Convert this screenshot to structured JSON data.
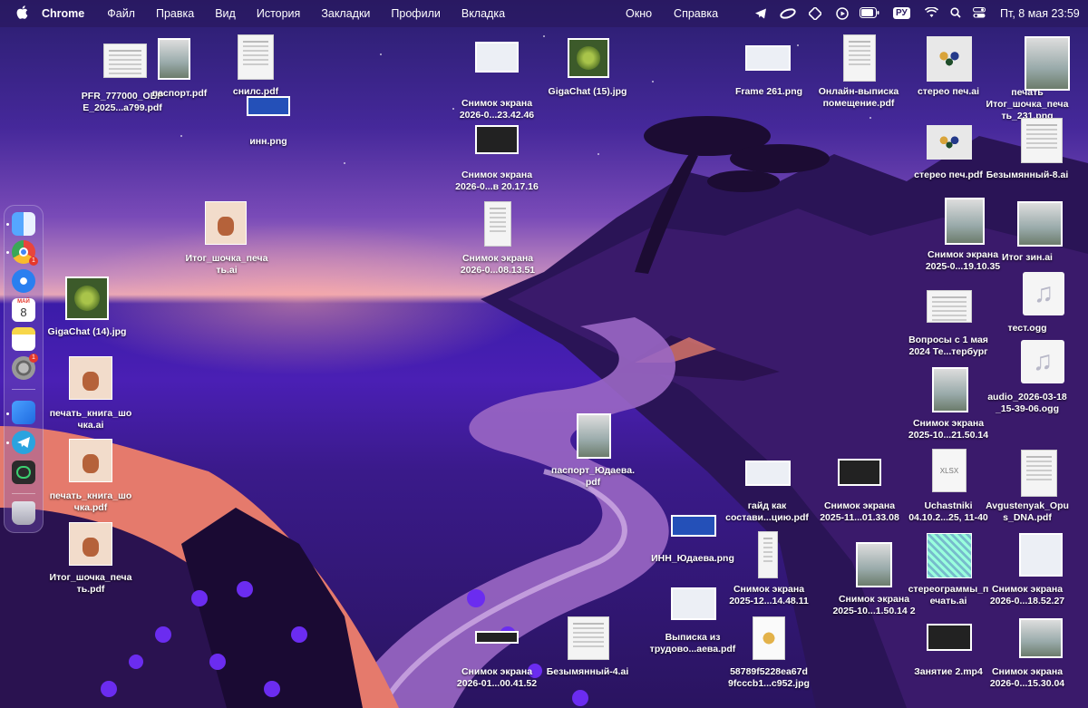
{
  "menubar": {
    "app_name": "Chrome",
    "menus": [
      "Файл",
      "Правка",
      "Вид",
      "История",
      "Закладки",
      "Профили",
      "Вкладка"
    ],
    "right_menus": [
      "Окно",
      "Справка"
    ],
    "input_source": "РУ",
    "clock": "Пт, 8 мая  23:59"
  },
  "dock": {
    "apps": [
      {
        "name": "finder-icon",
        "color": "#3e8ef7"
      },
      {
        "name": "chrome-icon",
        "color": "#e8e8e8",
        "badge": "1"
      },
      {
        "name": "safari-icon",
        "color": "#2a7ff0"
      },
      {
        "name": "calendar-icon",
        "color": "#ffffff",
        "month": "МАЙ",
        "day": "8"
      },
      {
        "name": "notes-icon",
        "color": "#f7d64a"
      },
      {
        "name": "settings-icon",
        "color": "#8e8e93",
        "badge": "1"
      },
      {
        "name": "zoom-icon",
        "color": "#2d8cff"
      },
      {
        "name": "telegram-icon",
        "color": "#2aa3df"
      },
      {
        "name": "facetime-icon",
        "color": "#2b2b2b"
      },
      {
        "name": "trash-icon",
        "color": "#c8c8d0"
      }
    ]
  },
  "desktop_files": [
    {
      "label": "PFR_777000_ОБР\nE_2025...a799.pdf",
      "kind": "doc"
    },
    {
      "label": "паспорт.pdf",
      "kind": "photo"
    },
    {
      "label": "снилс.pdf",
      "kind": "doc"
    },
    {
      "label": "инн.png",
      "kind": "blue"
    },
    {
      "label": "Снимок экрана\n2026-0...23.42.46",
      "kind": "shot"
    },
    {
      "label": "GigaChat (15).jpg",
      "kind": "virus"
    },
    {
      "label": "Frame 261.png",
      "kind": "shot"
    },
    {
      "label": "Онлайн-выписка\nпомещение.pdf",
      "kind": "doc"
    },
    {
      "label": "стерео печ.ai",
      "kind": "stereo"
    },
    {
      "label": "печать\nИтог_шочка_печа\nть_231.png",
      "kind": "photo"
    },
    {
      "label": "Снимок экрана\n2026-0...в 20.17.16",
      "kind": "dark"
    },
    {
      "label": "стерео печ.pdf",
      "kind": "stereo"
    },
    {
      "label": "Безымянный-8.ai",
      "kind": "doc"
    },
    {
      "label": "Итог_шочка_печа\nть.ai",
      "kind": "bear"
    },
    {
      "label": "Снимок экрана\n2026-0...08.13.51",
      "kind": "doc"
    },
    {
      "label": "Снимок экрана\n2025-0...19.10.35",
      "kind": "photo"
    },
    {
      "label": "Итог зин.ai",
      "kind": "photo"
    },
    {
      "label": "GigaChat (14).jpg",
      "kind": "virus"
    },
    {
      "label": "тест.ogg",
      "kind": "music"
    },
    {
      "label": "Вопросы с 1 мая\n2024 Те...тербург",
      "kind": "doc"
    },
    {
      "label": "печать_книга_шо\nчка.ai",
      "kind": "bear"
    },
    {
      "label": "audio_2026-03-18\n_15-39-06.ogg",
      "kind": "music"
    },
    {
      "label": "Снимок экрана\n2025-10...21.50.14",
      "kind": "photo"
    },
    {
      "label": "паспорт_Юдаева.\npdf",
      "kind": "photo"
    },
    {
      "label": "печать_книга_шо\nчка.pdf",
      "kind": "bear"
    },
    {
      "label": "гайд как\nсостави...цию.pdf",
      "kind": "shot"
    },
    {
      "label": "Снимок экрана\n2025-11...01.33.08",
      "kind": "dark"
    },
    {
      "label": "Uchastniki\n04.10.2...25, 11-40",
      "kind": "xlsx"
    },
    {
      "label": "Avgustenyak_Opu\ns_DNA.pdf",
      "kind": "doc"
    },
    {
      "label": "Итог_шочка_печа\nть.pdf",
      "kind": "bear"
    },
    {
      "label": "ИНН_Юдаева.png",
      "kind": "blue"
    },
    {
      "label": "Снимок экрана\n2025-12...14.48.11",
      "kind": "doc"
    },
    {
      "label": "Снимок экрана\n2025-10...1.50.14 2",
      "kind": "photo"
    },
    {
      "label": "стереограммы_п\nечать.ai",
      "kind": "pattern"
    },
    {
      "label": "Снимок экрана\n2026-0...18.52.27",
      "kind": "shot"
    },
    {
      "label": "Выписка из\nтрудово...аева.pdf",
      "kind": "shot"
    },
    {
      "label": "Снимок экрана\n2026-01...00.41.52",
      "kind": "dark"
    },
    {
      "label": "Безымянный-4.ai",
      "kind": "doc"
    },
    {
      "label": "58789f5228ea67d\n9fcccb1...c952.jpg",
      "kind": "gold"
    },
    {
      "label": "Занятие 2.mp4",
      "kind": "dark"
    },
    {
      "label": "Снимок экрана\n2026-0...15.30.04",
      "kind": "photo"
    }
  ]
}
